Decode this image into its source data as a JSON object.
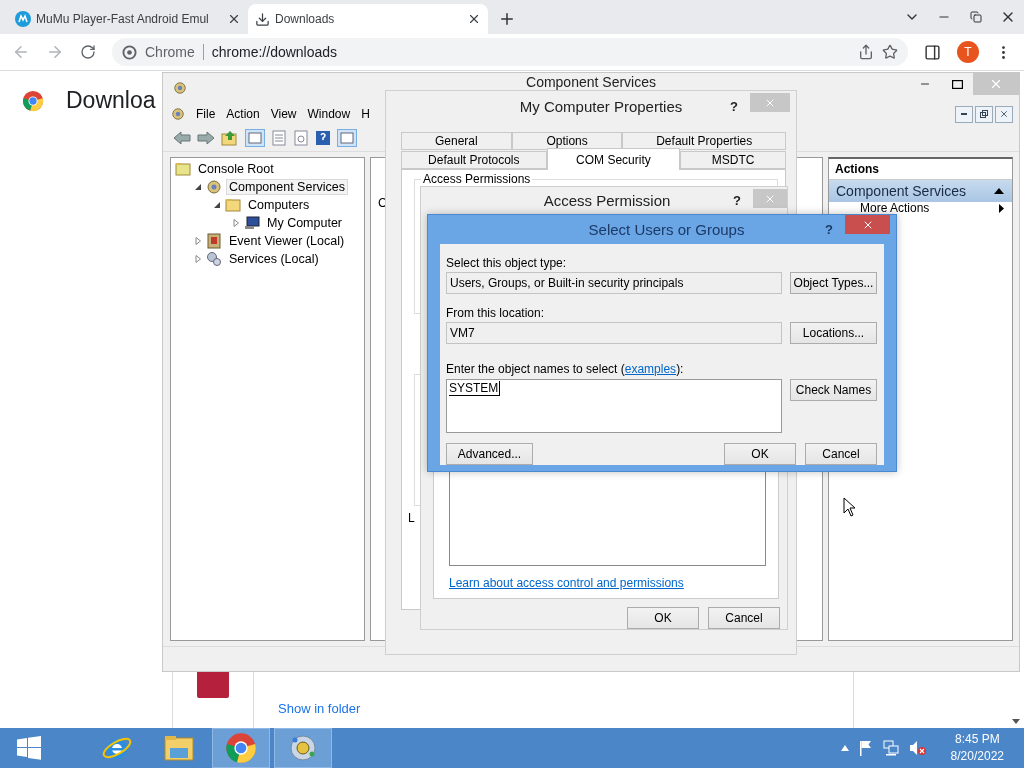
{
  "browser": {
    "tabs": [
      {
        "title": "MuMu Player-Fast Android Emul",
        "kind": "mumu",
        "selected": false
      },
      {
        "title": "Downloads",
        "kind": "download",
        "selected": true
      }
    ],
    "omnibox": {
      "site": "Chrome",
      "url": "chrome://downloads"
    },
    "profile_initial": "T",
    "page": {
      "heading": "Downloa",
      "link": "Show in folder"
    }
  },
  "mmc": {
    "title": "Component Services",
    "menu": [
      "File",
      "Action",
      "View",
      "Window",
      "H"
    ],
    "tree": {
      "label": "Console Root",
      "children": [
        {
          "label": "Component Services",
          "kind": "component",
          "expanded": true,
          "selected": true,
          "children": [
            {
              "label": "Computers",
              "kind": "folder",
              "expanded": true,
              "selected": false,
              "children": [
                {
                  "label": "My Computer",
                  "kind": "computer",
                  "expanded": false,
                  "selected": false
                }
              ]
            }
          ]
        },
        {
          "label": "Event Viewer (Local)",
          "kind": "events",
          "expanded": false,
          "selected": false
        },
        {
          "label": "Services (Local)",
          "kind": "services",
          "expanded": false,
          "selected": false
        }
      ]
    },
    "middle_text": "C",
    "actions": {
      "header": "Actions",
      "section": "Component Services",
      "items": [
        "More Actions"
      ]
    }
  },
  "properties": {
    "title": "My Computer Properties",
    "help": "?",
    "tab_rows": [
      [
        {
          "label": "General",
          "selected": false
        },
        {
          "label": "Options",
          "selected": false
        },
        {
          "label": "Default Properties",
          "selected": false
        }
      ],
      [
        {
          "label": "Default Protocols",
          "selected": false
        },
        {
          "label": "COM Security",
          "selected": true
        },
        {
          "label": "MSDTC",
          "selected": false
        }
      ]
    ],
    "group": "Access Permissions",
    "cut_label": "L"
  },
  "access": {
    "title": "Access Permission",
    "help": "?",
    "link": "Learn about access control and permissions",
    "buttons": [
      "OK",
      "Cancel"
    ]
  },
  "select": {
    "title": "Select Users or Groups",
    "help": "?",
    "object_type_label": "Select this object type:",
    "object_type": "Users, Groups, or Built-in security principals",
    "object_types_button": "Object Types...",
    "location_label": "From this location:",
    "location": "VM7",
    "locations_button": "Locations...",
    "names_label_start": "Enter the object names to select (",
    "names_link": "examples",
    "names_label_end": "):",
    "names_value": "SYSTEM",
    "check_names_button": "Check Names",
    "advanced_button": "Advanced...",
    "buttons": [
      "OK",
      "Cancel"
    ]
  },
  "taskbar": {
    "apps": [
      {
        "kind": "ie",
        "selected": false
      },
      {
        "kind": "explorer",
        "selected": false
      },
      {
        "kind": "chrome",
        "selected": true
      },
      {
        "kind": "mmc",
        "selected": true
      }
    ],
    "time": "8:45 PM",
    "date": "8/20/2022"
  }
}
